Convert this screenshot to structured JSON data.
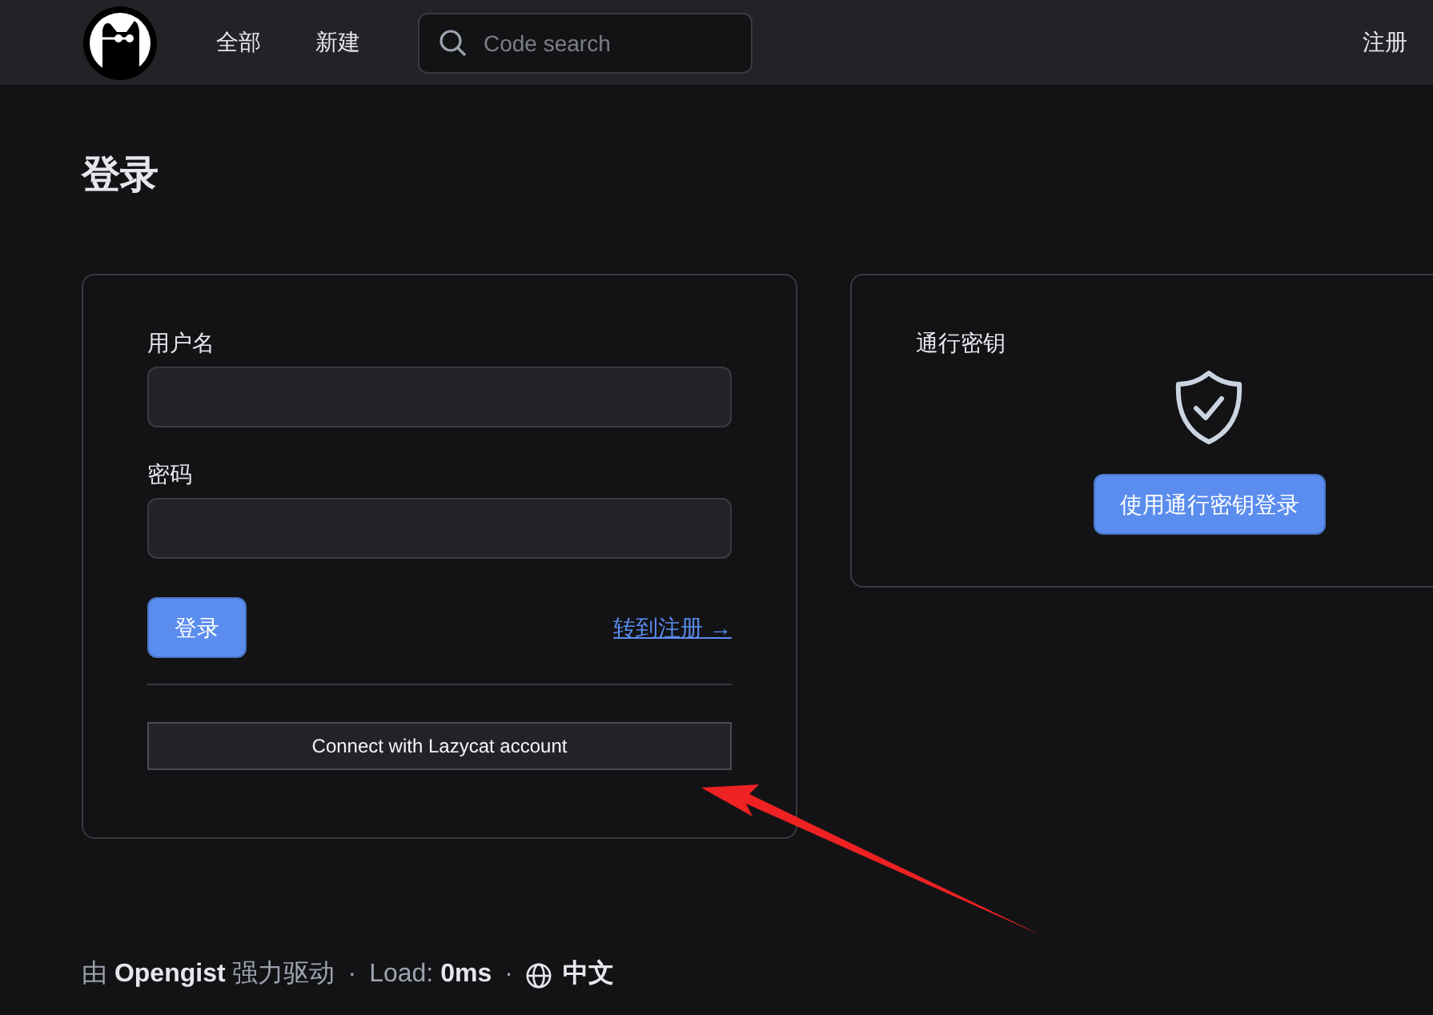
{
  "header": {
    "nav": [
      "全部",
      "新建"
    ],
    "search": {
      "placeholder": "Code search"
    },
    "register_link": "注册"
  },
  "title": "登录",
  "login_form": {
    "fields": [
      {
        "label": "用户名"
      },
      {
        "label": "密码"
      }
    ],
    "submit": "登录",
    "register_link": "转到注册 →",
    "oauth_button": "Connect with Lazycat account"
  },
  "passkey": {
    "title": "通行密钥",
    "button": "使用通行密钥登录"
  },
  "footer": {
    "separators": [
      "·",
      "·"
    ],
    "by": "由",
    "brand": "Opengist",
    "powered": "强力驱动",
    "load_label": "Load:",
    "load_value": "0ms",
    "language": "中文"
  }
}
